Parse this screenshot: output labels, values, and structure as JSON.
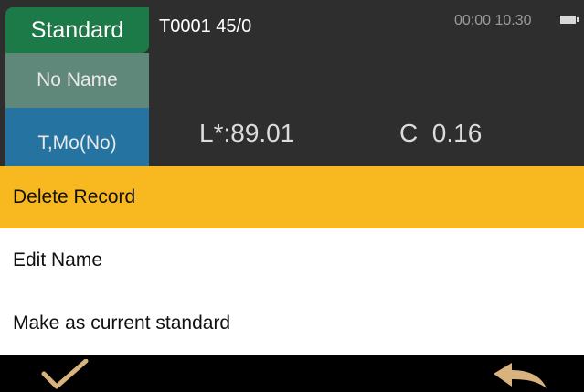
{
  "header": {
    "tabs": [
      "Standard",
      "No Name",
      "T,Mo(No)"
    ],
    "record_info": "T0001 45/0",
    "clock": "00:00 10.30"
  },
  "readings": {
    "l_value": "L*:89.01",
    "c_value": "C  0.16"
  },
  "menu": {
    "items": [
      "Delete Record",
      "Edit Name",
      "Make as current standard"
    ],
    "selected_index": 0
  },
  "toolbar": {
    "confirm_icon": "checkmark-icon",
    "back_icon": "back-arrow-icon"
  },
  "colors": {
    "standard_tab": "#1b7a48",
    "name_tab": "#5f877a",
    "mode_tab": "#2473a0",
    "selected_item": "#f8b81f",
    "icon": "#d8b37e"
  }
}
